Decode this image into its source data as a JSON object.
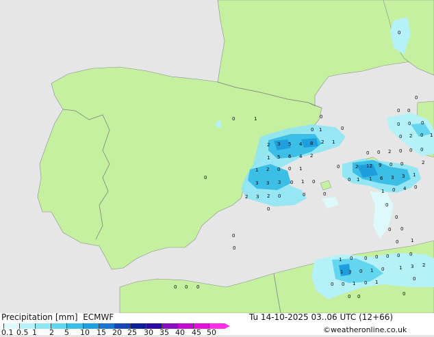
{
  "legend": {
    "title": "Precipitation [mm]",
    "model": "ECMWF",
    "ticks": [
      "0.1",
      "0.5",
      "1",
      "2",
      "5",
      "10",
      "15",
      "20",
      "25",
      "30",
      "35",
      "40",
      "45",
      "50"
    ],
    "colors": [
      "#ddf9fb",
      "#b5f1f8",
      "#8ee6f4",
      "#63d5ee",
      "#3bbfe6",
      "#1d9fdd",
      "#1b74cf",
      "#1646b6",
      "#0c1f94",
      "#2a0aa0",
      "#8a0fc2",
      "#c30bd0",
      "#e012da",
      "#ff2fe8"
    ]
  },
  "valid_time": "Tu 14-10-2025 03..06 UTC (12+66)",
  "credit": "©weatheronline.co.uk",
  "map": {
    "land_color": "#c4f0a0",
    "sea_color": "#e6e6e6",
    "border_color": "#808080"
  }
}
